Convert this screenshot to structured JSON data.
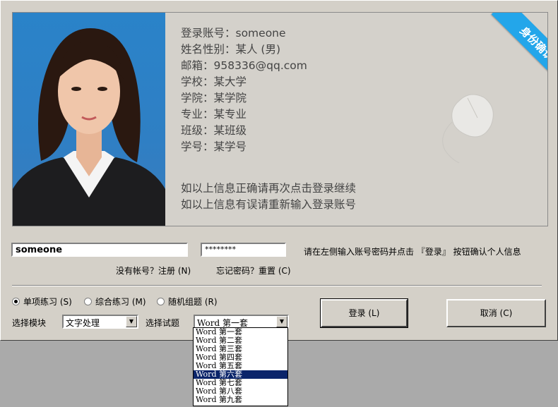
{
  "profile": {
    "lines": [
      "登录账号：someone",
      "姓名性别：某人 (男)",
      "邮箱：958336@qq.com",
      "学校：某大学",
      "学院：某学院",
      "专业：某专业",
      "班级：某班级",
      "学号：某学号"
    ],
    "notice1": "如以上信息正确请再次点击登录继续",
    "notice2": "如以上信息有误请重新输入登录账号",
    "ribbon": "身份确认"
  },
  "login": {
    "username_value": "someone",
    "password_value": "********",
    "instruction": "请在左侧输入账号密码并点击 『登录』 按钮确认个人信息",
    "register_link": "没有帐号？注册 (N)",
    "forgot_link": "忘记密码？重置 (C)"
  },
  "modes": [
    {
      "label": "单项练习 (S)",
      "checked": true
    },
    {
      "label": "综合练习 (M)",
      "checked": false
    },
    {
      "label": "随机组题 (R)",
      "checked": false
    }
  ],
  "module": {
    "label": "选择模块",
    "value": "文字处理"
  },
  "test": {
    "label": "选择试题",
    "value": "Word 第一套",
    "options": [
      "Word 第一套",
      "Word 第二套",
      "Word 第三套",
      "Word 第四套",
      "Word 第五套",
      "Word 第六套",
      "Word 第七套",
      "Word 第八套",
      "Word 第九套"
    ],
    "highlighted_index": 5
  },
  "buttons": {
    "login": "登录 (L)",
    "cancel": "取消 (C)"
  },
  "icons": {
    "combo_arrow": "▼"
  },
  "colors": {
    "ribbon": "#23a6ea",
    "selection": "#0a246a"
  }
}
